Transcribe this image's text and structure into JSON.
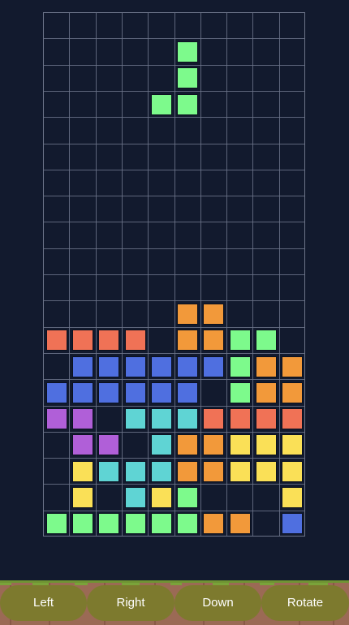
{
  "board": {
    "cols": 10,
    "rows": 20,
    "colors": {
      "green": "#7dfa8c",
      "orange": "#f2993a",
      "red": "#f07256",
      "blue": "#4f6fe0",
      "purple": "#b05fd8",
      "cyan": "#5fd4d4",
      "yellow": "#fae057",
      "background": "#121a2e",
      "grid": "#6b7388"
    },
    "active_piece": {
      "shape": "J",
      "color": "green",
      "cells": [
        [
          5,
          1
        ],
        [
          5,
          2
        ],
        [
          5,
          3
        ],
        [
          4,
          3
        ]
      ]
    },
    "locked_rows": [
      "..........",
      "..........",
      "..........",
      "..........",
      "..........",
      "..........",
      "..........",
      "..........",
      "..........",
      "..........",
      "..........",
      ".....OO...",
      "RRRR.OOGG.",
      ".BBBBBBGOO",
      "BBBBBB.GOO",
      "PP.CCCRRRR",
      ".PP.COOYYY",
      ".YCCCOOYYY",
      ".Y.CYG...Y",
      "GGGGGGOO.B"
    ],
    "legend": {
      "G": "green",
      "O": "orange",
      "R": "red",
      "B": "blue",
      "P": "purple",
      "C": "cyan",
      "Y": "yellow"
    }
  },
  "controls": {
    "left_label": "Left",
    "right_label": "Right",
    "down_label": "Down",
    "rotate_label": "Rotate",
    "button_color": "#7d7a2e",
    "ground_color": "#9b6a55",
    "grass_color": "#7aa33a"
  }
}
